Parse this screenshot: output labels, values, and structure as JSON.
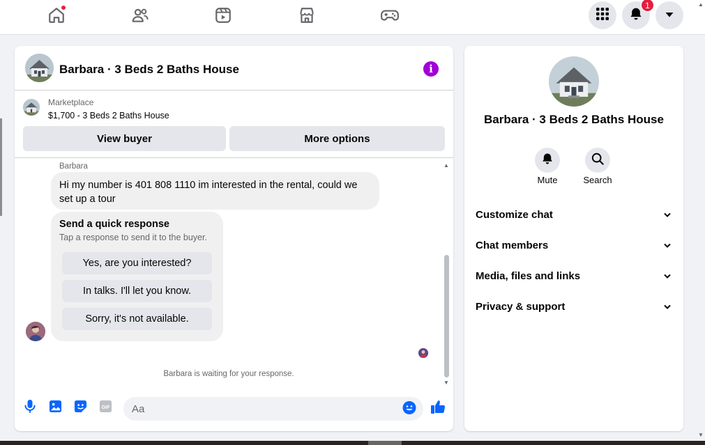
{
  "topnav": {
    "items": [
      {
        "name": "home-icon",
        "has_dot": true
      },
      {
        "name": "friends-icon"
      },
      {
        "name": "watch-icon"
      },
      {
        "name": "marketplace-icon"
      },
      {
        "name": "gaming-icon"
      }
    ],
    "notifications_count": "1",
    "colors": {
      "dot": "#e41e3f",
      "icon": "#65676b"
    }
  },
  "chat": {
    "title": "Barbara · 3 Beds 2 Baths House",
    "listing": {
      "source_label": "Marketplace",
      "price_title": "$1,700 - 3 Beds 2 Baths House"
    },
    "buttons": {
      "view_buyer": "View buyer",
      "more_options": "More options"
    },
    "messages": {
      "sender_name": "Barbara",
      "text": "Hi my number is 401 808 1110  im interested in the rental, could we set up a tour"
    },
    "quick_response": {
      "title": "Send a quick response",
      "subtitle": "Tap a response to send it to the buyer.",
      "options": [
        "Yes, are you interested?",
        "In talks. I'll let you know.",
        "Sorry, it's not available."
      ]
    },
    "status": "Barbara is waiting for your response.",
    "composer": {
      "placeholder": "Aa",
      "accent": "#0866ff"
    }
  },
  "details": {
    "title": "Barbara · 3 Beds 2 Baths House",
    "actions": [
      {
        "label": "Mute",
        "icon": "bell-icon"
      },
      {
        "label": "Search",
        "icon": "search-icon"
      }
    ],
    "sections": [
      "Customize chat",
      "Chat members",
      "Media, files and links",
      "Privacy & support"
    ]
  },
  "colors": {
    "info": "#a100d6",
    "bubble": "#f0f0f0",
    "button": "#e4e6eb"
  }
}
